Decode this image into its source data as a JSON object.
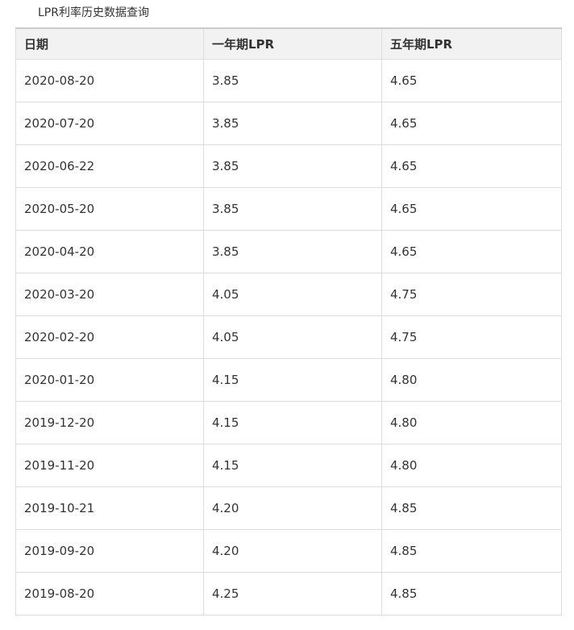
{
  "caption": "LPR利率历史数据查询",
  "table": {
    "headers": [
      "日期",
      "一年期LPR",
      "五年期LPR"
    ],
    "rows": [
      [
        "2020-08-20",
        "3.85",
        "4.65"
      ],
      [
        "2020-07-20",
        "3.85",
        "4.65"
      ],
      [
        "2020-06-22",
        "3.85",
        "4.65"
      ],
      [
        "2020-05-20",
        "3.85",
        "4.65"
      ],
      [
        "2020-04-20",
        "3.85",
        "4.65"
      ],
      [
        "2020-03-20",
        "4.05",
        "4.75"
      ],
      [
        "2020-02-20",
        "4.05",
        "4.75"
      ],
      [
        "2020-01-20",
        "4.15",
        "4.80"
      ],
      [
        "2019-12-20",
        "4.15",
        "4.80"
      ],
      [
        "2019-11-20",
        "4.15",
        "4.80"
      ],
      [
        "2019-10-21",
        "4.20",
        "4.85"
      ],
      [
        "2019-09-20",
        "4.20",
        "4.85"
      ],
      [
        "2019-08-20",
        "4.25",
        "4.85"
      ]
    ]
  },
  "colors": {
    "header_bg": "#f2f2f2",
    "border": "#dddddd",
    "text": "#333333"
  }
}
